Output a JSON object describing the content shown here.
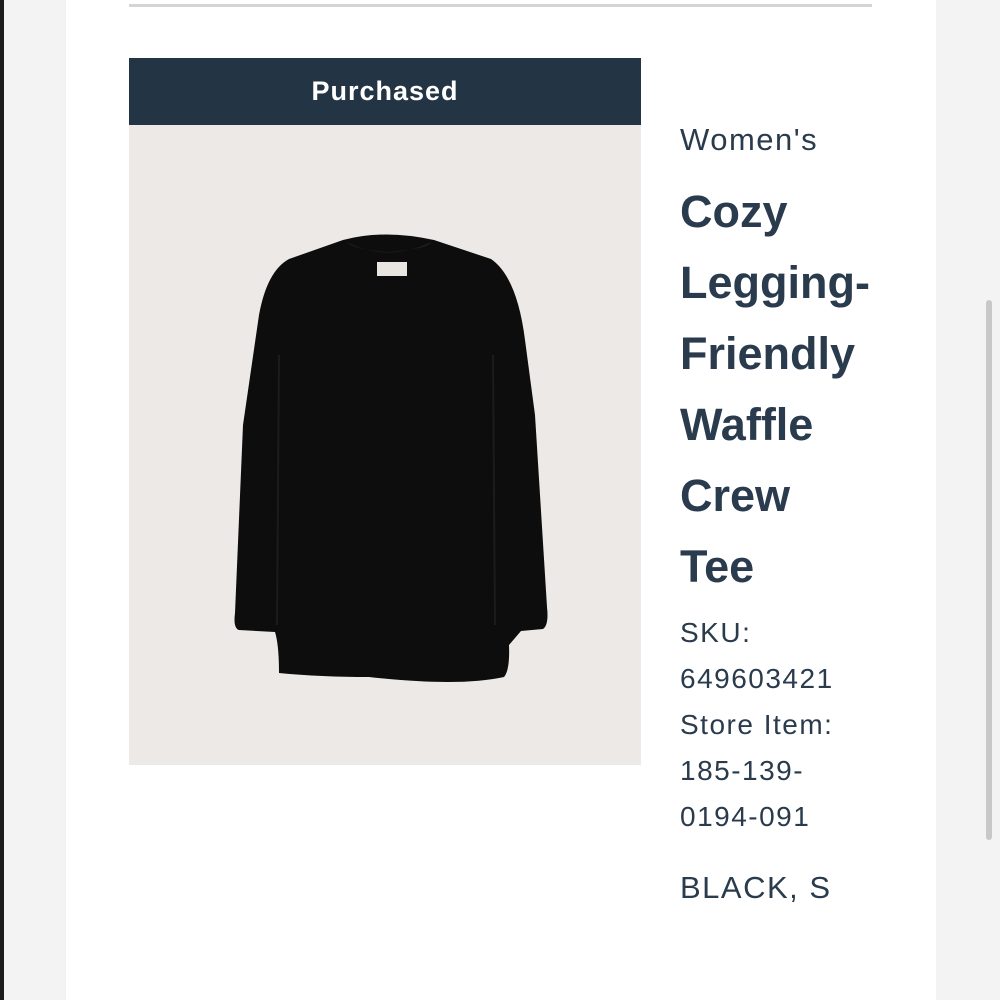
{
  "product": {
    "status_badge": "Purchased",
    "gender": "Women's",
    "title_lines": [
      "Cozy",
      "Legging-",
      "Friendly",
      "Waffle",
      "Crew",
      "Tee"
    ],
    "sku_label": "SKU:",
    "sku_value": "649603421",
    "store_item_label": "Store Item:",
    "store_item_lines": [
      "185-139-",
      "0194-091"
    ],
    "variant": "BLACK, S",
    "image_icon": "black-long-sleeve-tee-image"
  },
  "colors": {
    "banner_bg": "#233445",
    "text": "#2a3b4d",
    "image_bg": "#ede9e6",
    "garment": "#0d0d0d"
  }
}
